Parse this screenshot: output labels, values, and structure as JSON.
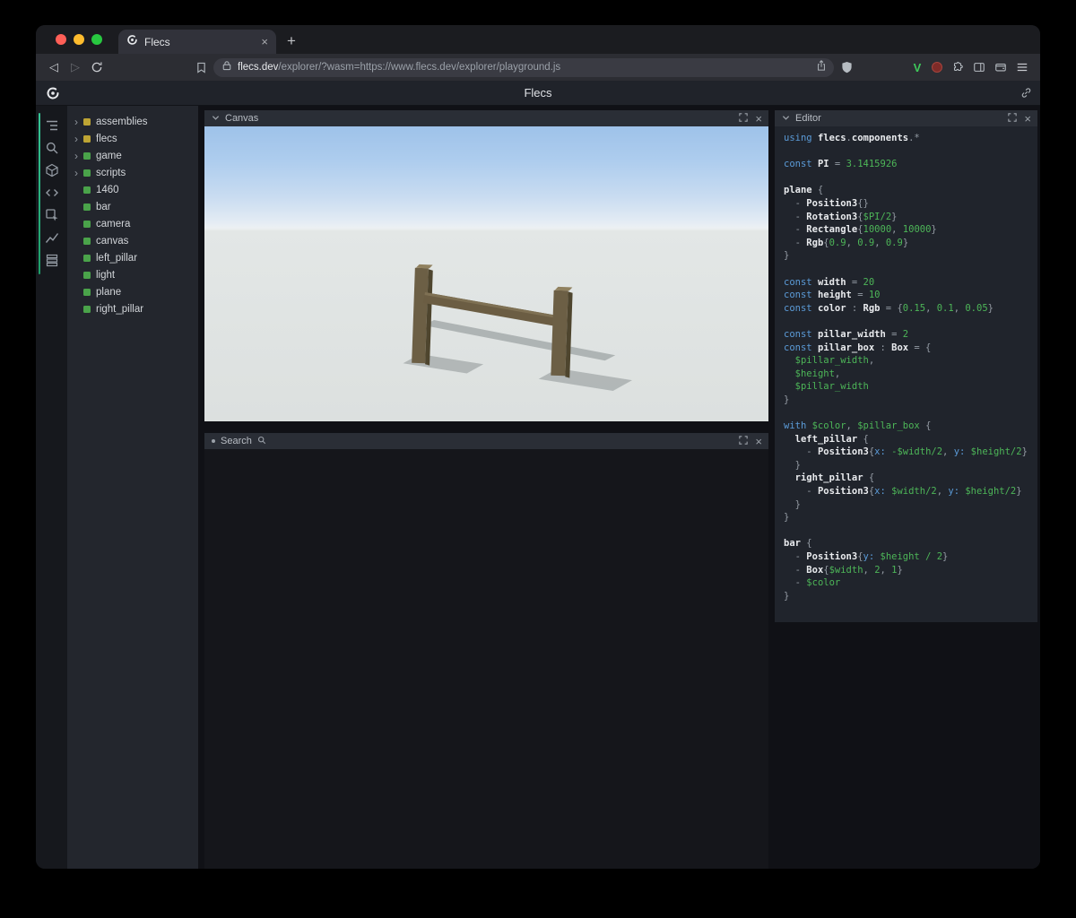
{
  "colors": {
    "entity_yellow": "#bda434",
    "entity_green": "#4aa34a",
    "accent_teal": "#27a17c",
    "traffic_red": "#ff5f57",
    "traffic_yellow": "#febc2e",
    "traffic_green": "#28c840",
    "v_badge_green": "#3ec75a",
    "code_keyword": "#5b9bd8",
    "code_identifier": "#e9ebee",
    "code_punctuation": "#949ba4",
    "code_value": "#4db658"
  },
  "glyphs": {
    "close": "×",
    "plus": "+",
    "back": "◁",
    "forward": "▷",
    "chevron_right": "›"
  },
  "browser": {
    "tab_title": "Flecs",
    "url": "flecs.dev/explorer/?wasm=https://www.flecs.dev/explorer/playground.js",
    "url_host": "flecs.dev",
    "url_path": "/explorer/?wasm=https://www.flecs.dev/explorer/playground.js",
    "v_badge": "V"
  },
  "app_header": {
    "title": "Flecs"
  },
  "rail": {
    "icons": [
      "outline-icon",
      "search-icon",
      "entities-icon",
      "code-icon",
      "inspector-icon",
      "stats-icon",
      "rows-icon"
    ]
  },
  "tree": {
    "items": [
      {
        "label": "assemblies",
        "color": "entity_yellow",
        "expandable": true
      },
      {
        "label": "flecs",
        "color": "entity_yellow",
        "expandable": true
      },
      {
        "label": "game",
        "color": "entity_green",
        "expandable": true
      },
      {
        "label": "scripts",
        "color": "entity_green",
        "expandable": true
      },
      {
        "label": "1460",
        "color": "entity_green",
        "expandable": false
      },
      {
        "label": "bar",
        "color": "entity_green",
        "expandable": false
      },
      {
        "label": "camera",
        "color": "entity_green",
        "expandable": false
      },
      {
        "label": "canvas",
        "color": "entity_green",
        "expandable": false
      },
      {
        "label": "left_pillar",
        "color": "entity_green",
        "expandable": false
      },
      {
        "label": "light",
        "color": "entity_green",
        "expandable": false
      },
      {
        "label": "plane",
        "color": "entity_green",
        "expandable": false
      },
      {
        "label": "right_pillar",
        "color": "entity_green",
        "expandable": false
      }
    ]
  },
  "panels": {
    "canvas": {
      "title": "Canvas"
    },
    "search": {
      "title": "Search"
    },
    "editor": {
      "title": "Editor"
    }
  },
  "editor": {
    "lines": [
      [
        [
          "using ",
          "k"
        ],
        [
          "flecs",
          "i"
        ],
        [
          ".",
          "p"
        ],
        [
          "components",
          "i"
        ],
        [
          ".*",
          "p"
        ]
      ],
      [],
      [
        [
          "const ",
          "k"
        ],
        [
          "PI",
          "i"
        ],
        [
          " = ",
          "p"
        ],
        [
          "3.1415926",
          "v"
        ]
      ],
      [],
      [
        [
          "plane",
          "i"
        ],
        [
          " {",
          "p"
        ]
      ],
      [
        [
          "  - ",
          "p"
        ],
        [
          "Position3",
          "i"
        ],
        [
          "{}",
          "p"
        ]
      ],
      [
        [
          "  - ",
          "p"
        ],
        [
          "Rotation3",
          "i"
        ],
        [
          "{",
          "p"
        ],
        [
          "$PI/2",
          "v"
        ],
        [
          "}",
          "p"
        ]
      ],
      [
        [
          "  - ",
          "p"
        ],
        [
          "Rectangle",
          "i"
        ],
        [
          "{",
          "p"
        ],
        [
          "10000",
          "v"
        ],
        [
          ", ",
          "p"
        ],
        [
          "10000",
          "v"
        ],
        [
          "}",
          "p"
        ]
      ],
      [
        [
          "  - ",
          "p"
        ],
        [
          "Rgb",
          "i"
        ],
        [
          "{",
          "p"
        ],
        [
          "0.9",
          "v"
        ],
        [
          ", ",
          "p"
        ],
        [
          "0.9",
          "v"
        ],
        [
          ", ",
          "p"
        ],
        [
          "0.9",
          "v"
        ],
        [
          "}",
          "p"
        ]
      ],
      [
        [
          "}",
          "p"
        ]
      ],
      [],
      [
        [
          "const ",
          "k"
        ],
        [
          "width",
          "i"
        ],
        [
          " = ",
          "p"
        ],
        [
          "20",
          "v"
        ]
      ],
      [
        [
          "const ",
          "k"
        ],
        [
          "height",
          "i"
        ],
        [
          " = ",
          "p"
        ],
        [
          "10",
          "v"
        ]
      ],
      [
        [
          "const ",
          "k"
        ],
        [
          "color",
          "i"
        ],
        [
          " : ",
          "p"
        ],
        [
          "Rgb",
          "i"
        ],
        [
          " = {",
          "p"
        ],
        [
          "0.15",
          "v"
        ],
        [
          ", ",
          "p"
        ],
        [
          "0.1",
          "v"
        ],
        [
          ", ",
          "p"
        ],
        [
          "0.05",
          "v"
        ],
        [
          "}",
          "p"
        ]
      ],
      [],
      [
        [
          "const ",
          "k"
        ],
        [
          "pillar_width",
          "i"
        ],
        [
          " = ",
          "p"
        ],
        [
          "2",
          "v"
        ]
      ],
      [
        [
          "const ",
          "k"
        ],
        [
          "pillar_box",
          "i"
        ],
        [
          " : ",
          "p"
        ],
        [
          "Box",
          "i"
        ],
        [
          " = {",
          "p"
        ]
      ],
      [
        [
          "  ",
          "p"
        ],
        [
          "$pillar_width",
          "v"
        ],
        [
          ",",
          "p"
        ]
      ],
      [
        [
          "  ",
          "p"
        ],
        [
          "$height",
          "v"
        ],
        [
          ",",
          "p"
        ]
      ],
      [
        [
          "  ",
          "p"
        ],
        [
          "$pillar_width",
          "v"
        ]
      ],
      [
        [
          "}",
          "p"
        ]
      ],
      [],
      [
        [
          "with ",
          "k"
        ],
        [
          "$color",
          "v"
        ],
        [
          ", ",
          "p"
        ],
        [
          "$pillar_box",
          "v"
        ],
        [
          " {",
          "p"
        ]
      ],
      [
        [
          "  ",
          "p"
        ],
        [
          "left_pillar",
          "i"
        ],
        [
          " {",
          "p"
        ]
      ],
      [
        [
          "    - ",
          "p"
        ],
        [
          "Position3",
          "i"
        ],
        [
          "{",
          "p"
        ],
        [
          "x: ",
          "m"
        ],
        [
          "-$width/2",
          "v"
        ],
        [
          ", ",
          "p"
        ],
        [
          "y: ",
          "m"
        ],
        [
          "$height/2",
          "v"
        ],
        [
          "}",
          "p"
        ]
      ],
      [
        [
          "  }",
          "p"
        ]
      ],
      [
        [
          "  ",
          "p"
        ],
        [
          "right_pillar",
          "i"
        ],
        [
          " {",
          "p"
        ]
      ],
      [
        [
          "    - ",
          "p"
        ],
        [
          "Position3",
          "i"
        ],
        [
          "{",
          "p"
        ],
        [
          "x: ",
          "m"
        ],
        [
          "$width/2",
          "v"
        ],
        [
          ", ",
          "p"
        ],
        [
          "y: ",
          "m"
        ],
        [
          "$height/2",
          "v"
        ],
        [
          "}",
          "p"
        ]
      ],
      [
        [
          "  }",
          "p"
        ]
      ],
      [
        [
          "}",
          "p"
        ]
      ],
      [],
      [
        [
          "bar",
          "i"
        ],
        [
          " {",
          "p"
        ]
      ],
      [
        [
          "  - ",
          "p"
        ],
        [
          "Position3",
          "i"
        ],
        [
          "{",
          "p"
        ],
        [
          "y: ",
          "m"
        ],
        [
          "$height / 2",
          "v"
        ],
        [
          "}",
          "p"
        ]
      ],
      [
        [
          "  - ",
          "p"
        ],
        [
          "Box",
          "i"
        ],
        [
          "{",
          "p"
        ],
        [
          "$width",
          "v"
        ],
        [
          ", ",
          "p"
        ],
        [
          "2",
          "v"
        ],
        [
          ", ",
          "p"
        ],
        [
          "1",
          "v"
        ],
        [
          "}",
          "p"
        ]
      ],
      [
        [
          "  - ",
          "p"
        ],
        [
          "$color",
          "v"
        ]
      ],
      [
        [
          "}",
          "p"
        ]
      ]
    ]
  }
}
